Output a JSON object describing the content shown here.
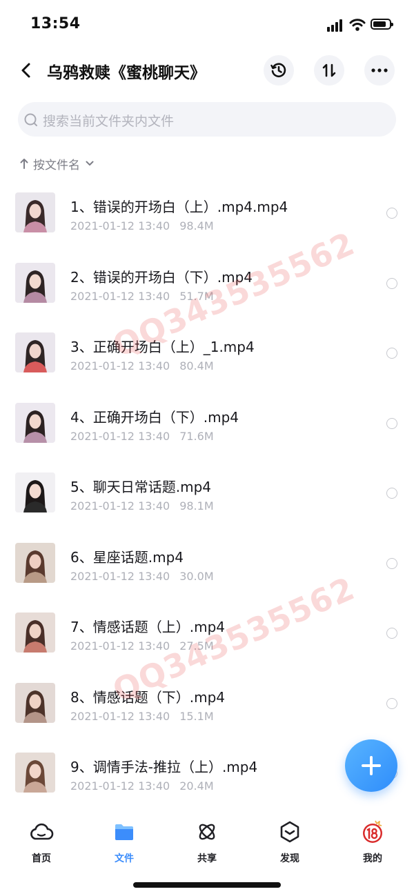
{
  "status_bar": {
    "time": "13:54"
  },
  "header": {
    "title": "乌鸦救赎《蜜桃聊天》"
  },
  "search": {
    "placeholder": "搜索当前文件夹内文件"
  },
  "sort": {
    "label": "按文件名"
  },
  "files": [
    {
      "name": "1、错误的开场白（上）.mp4.mp4",
      "date": "2021-01-12 13:40",
      "size": "98.4M"
    },
    {
      "name": "2、错误的开场白（下）.mp4",
      "date": "2021-01-12 13:40",
      "size": "51.7M"
    },
    {
      "name": "3、正确开场白（上）_1.mp4",
      "date": "2021-01-12 13:40",
      "size": "80.4M"
    },
    {
      "name": "4、正确开场白（下）.mp4",
      "date": "2021-01-12 13:40",
      "size": "71.6M"
    },
    {
      "name": "5、聊天日常话题.mp4",
      "date": "2021-01-12 13:40",
      "size": "98.1M"
    },
    {
      "name": "6、星座话题.mp4",
      "date": "2021-01-12 13:40",
      "size": "30.0M"
    },
    {
      "name": "7、情感话题（上）.mp4",
      "date": "2021-01-12 13:40",
      "size": "27.5M"
    },
    {
      "name": "8、情感话题（下）.mp4",
      "date": "2021-01-12 13:40",
      "size": "15.1M"
    },
    {
      "name": "9、调情手法-推拉（上）.mp4",
      "date": "2021-01-12 13:40",
      "size": "20.4M"
    }
  ],
  "watermark": {
    "text": "QQ343535562"
  },
  "bottom_nav": [
    {
      "label": "首页",
      "icon": "cloud-icon",
      "active": false
    },
    {
      "label": "文件",
      "icon": "folder-icon",
      "active": true
    },
    {
      "label": "共享",
      "icon": "atom-icon",
      "active": false
    },
    {
      "label": "发现",
      "icon": "compass-icon",
      "active": false
    },
    {
      "label": "我的",
      "icon": "avatar-icon",
      "active": false
    }
  ],
  "colors": {
    "accent": "#3c8dfb",
    "fab": "#2f8dfb",
    "watermark": "#e85050"
  }
}
